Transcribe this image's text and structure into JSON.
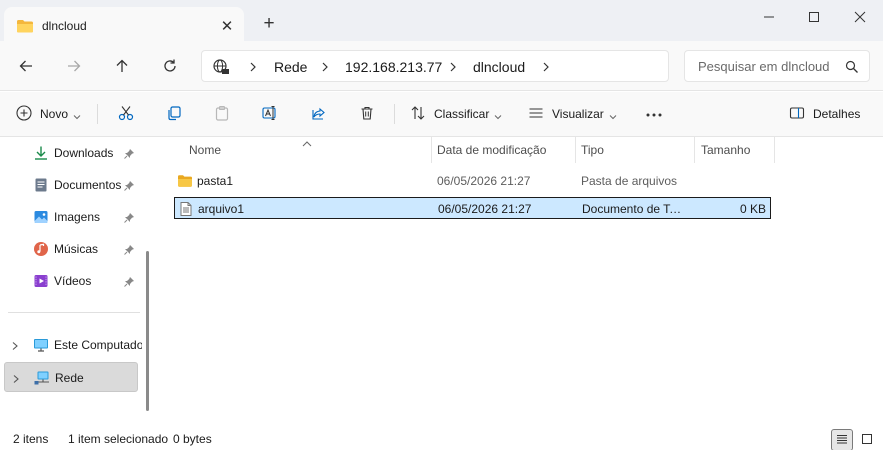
{
  "window": {
    "tab_title": "dlncloud",
    "close_tab_glyph": "✕",
    "new_tab_glyph": "+"
  },
  "address_bar": {
    "breadcrumbs": [
      "Rede",
      "192.168.213.77",
      "dlncloud"
    ],
    "search_placeholder": "Pesquisar em dlncloud"
  },
  "command_bar": {
    "new_label": "Novo",
    "sort_label": "Classificar",
    "view_label": "Visualizar",
    "details_label": "Detalhes"
  },
  "sidebar": {
    "quick_access": [
      {
        "label": "Downloads",
        "icon": "download-icon"
      },
      {
        "label": "Documentos",
        "icon": "documents-icon"
      },
      {
        "label": "Imagens",
        "icon": "images-icon"
      },
      {
        "label": "Músicas",
        "icon": "music-icon"
      },
      {
        "label": "Vídeos",
        "icon": "videos-icon"
      }
    ],
    "tree": [
      {
        "label": "Este Computador",
        "icon": "computer-icon"
      },
      {
        "label": "Rede",
        "icon": "network-icon",
        "selected": true
      }
    ]
  },
  "file_list": {
    "columns": [
      "Nome",
      "Data de modificação",
      "Tipo",
      "Tamanho"
    ],
    "rows": [
      {
        "name": "pasta1",
        "modified": "06/05/2026 21:27",
        "type": "Pasta de arquivos",
        "size": "",
        "icon": "folder-icon",
        "selected": false
      },
      {
        "name": "arquivo1",
        "modified": "06/05/2026 21:27",
        "type": "Documento de Texto",
        "size": "0 KB",
        "icon": "text-file-icon",
        "selected": true
      }
    ]
  },
  "status_bar": {
    "item_count": "2 itens",
    "selection": "1 item selecionado",
    "selection_size": "0 bytes"
  },
  "colors": {
    "selection_fill": "#cce8ff",
    "folder_yellow": "#f7c745",
    "accent_blue": "#0067c0"
  }
}
